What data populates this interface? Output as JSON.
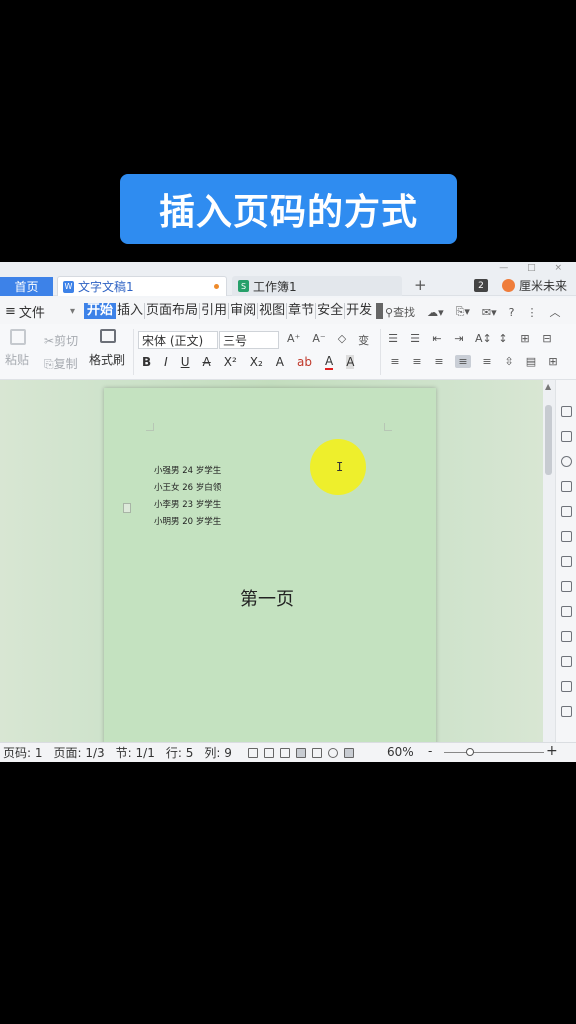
{
  "banner": {
    "title": "插入页码的方式"
  },
  "window": {
    "controls": "— □ ×"
  },
  "tabs": {
    "home": "首页",
    "doc": "文字文稿1",
    "doc_icon": "W",
    "sheet": "工作簿1",
    "sheet_icon": "S",
    "add": "+",
    "count": "2",
    "user": "厘米未来"
  },
  "menu": {
    "file": "文件",
    "file_icon": "≡",
    "items": [
      "开始",
      "插入",
      "页面布局",
      "引用",
      "审阅",
      "视图",
      "章节",
      "安全",
      "开发"
    ],
    "search": "查找",
    "help": "?"
  },
  "ribbon": {
    "paste": "粘贴",
    "cut": "剪切",
    "copy": "复制",
    "format_painter": "格式刷",
    "font_name": "宋体 (正文)",
    "font_size": "三号",
    "fmt_buttons": [
      "B",
      "I",
      "U",
      "A",
      "X²",
      "X₂",
      "A",
      "ab",
      "A",
      "A"
    ],
    "size_buttons": [
      "A⁺",
      "A⁻",
      "◇",
      "变"
    ],
    "para_top": [
      "☰",
      "☰",
      "⇤",
      "⇥",
      "A↕",
      "↕",
      "⊞",
      "⊟"
    ],
    "para_bottom": [
      "≡",
      "≡",
      "≡",
      "≡",
      "≡",
      "⇳",
      "▤",
      "⊞"
    ]
  },
  "document": {
    "lines": [
      "小强男 24 岁学生",
      "小王女 26 岁白领",
      "小李男 23 岁学生",
      "小明男 20 岁学生"
    ],
    "page_title": "第一页",
    "cursor_glyph": "I"
  },
  "status": {
    "page_num": "页码: 1",
    "page": "页面: 1/3",
    "section": "节: 1/1",
    "row": "行: 5",
    "col": "列: 9",
    "zoom": "60%",
    "zoom_minus": "-",
    "zoom_plus": "+"
  },
  "colors": {
    "accent": "#3d82e8",
    "banner": "#2f8cf0",
    "page": "#c4e2c0",
    "highlight": "#f1f01f"
  }
}
